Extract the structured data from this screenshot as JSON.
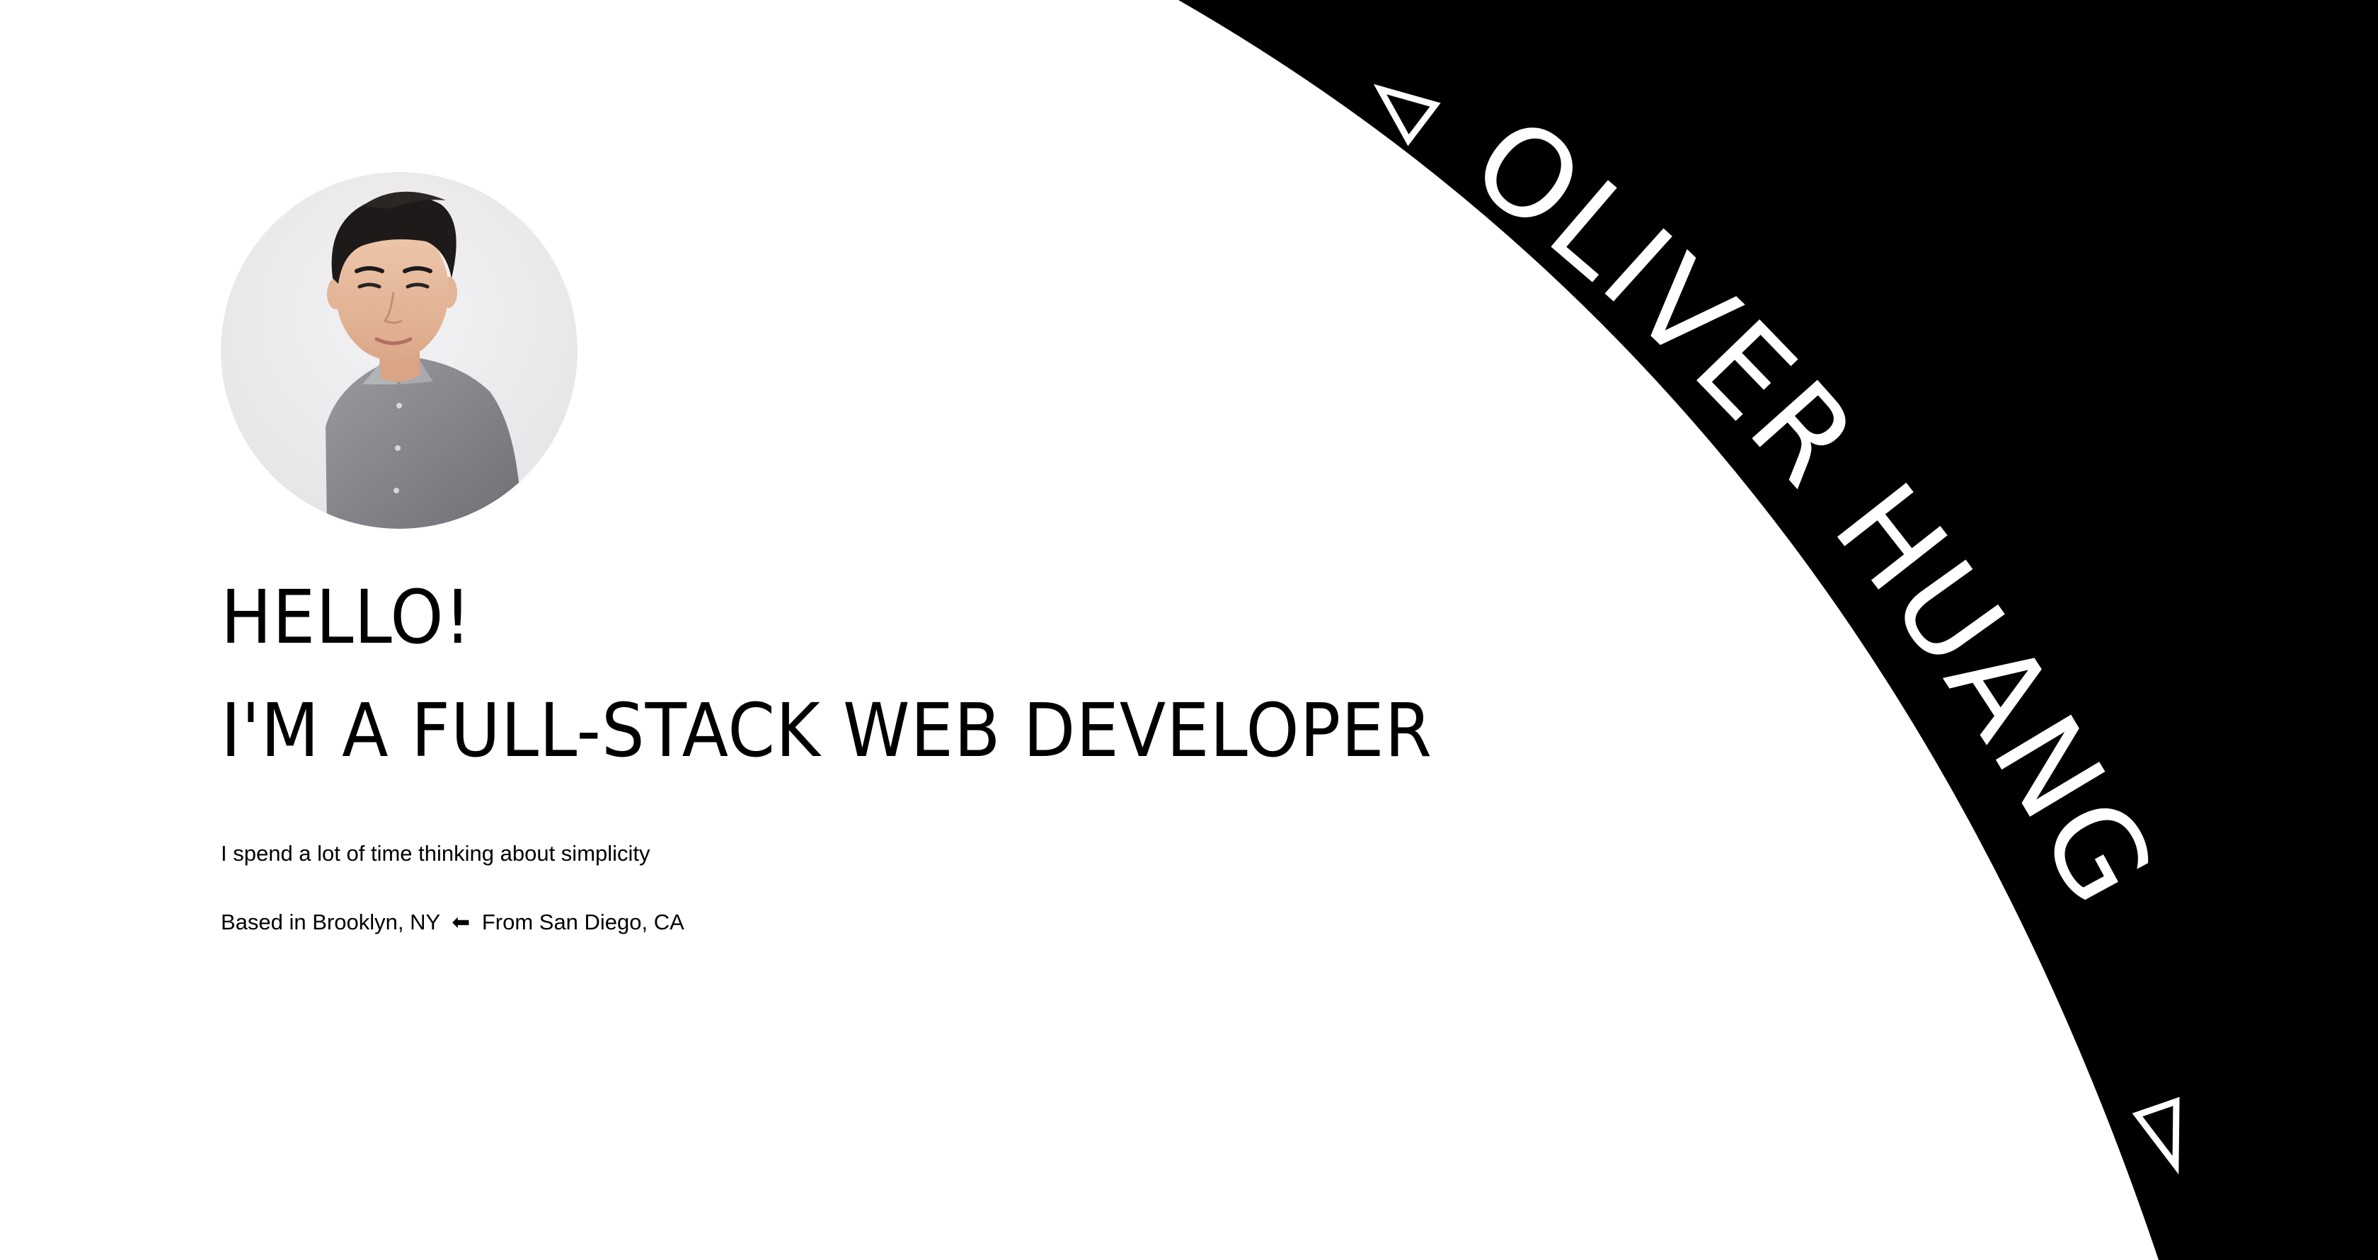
{
  "brand": {
    "name": "OLIVER HUANG"
  },
  "hero": {
    "greeting": "HELLO!",
    "role": "I'M A FULL-STACK WEB DEVELOPER",
    "tagline": "I spend a lot of time thinking about simplicity",
    "location": {
      "current": "Based in Brooklyn, NY",
      "arrow": "⬅",
      "origin": "From San Diego, CA"
    }
  },
  "avatar": {
    "alt": "Portrait of Oliver Huang"
  },
  "icons": {
    "arc_top": "triangle-outline-icon",
    "arc_bottom": "triangle-outline-icon"
  },
  "colors": {
    "background": "#ffffff",
    "panel": "#000000",
    "text": "#000000",
    "panel_text": "#ffffff"
  }
}
